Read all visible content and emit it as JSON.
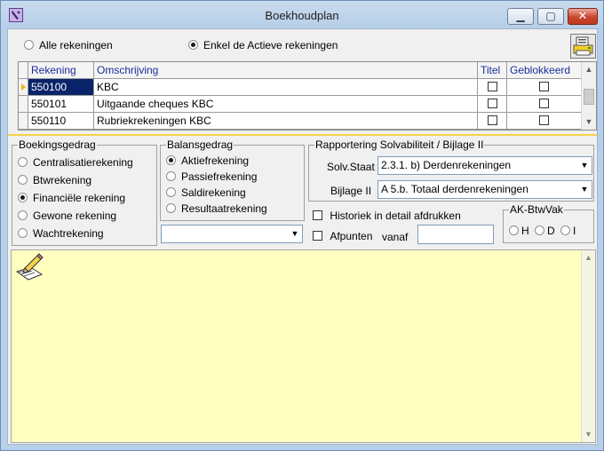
{
  "window": {
    "title": "Boekhoudplan",
    "min": "▁",
    "max": "▢",
    "close": "✕"
  },
  "filter": {
    "all_label": "Alle rekeningen",
    "active_label": "Enkel de Actieve rekeningen",
    "selected": "active"
  },
  "grid": {
    "headers": [
      "Rekening",
      "Omschrijving",
      "Titel",
      "Geblokkeerd"
    ],
    "rows": [
      {
        "rekening": "550100",
        "omschrijving": "KBC",
        "titel": false,
        "geblokkeerd": false
      },
      {
        "rekening": "550101",
        "omschrijving": "Uitgaande cheques KBC",
        "titel": false,
        "geblokkeerd": false
      },
      {
        "rekening": "550110",
        "omschrijving": "Rubriekrekeningen KBC",
        "titel": false,
        "geblokkeerd": false
      }
    ]
  },
  "boekingsgedrag": {
    "legend": "Boekingsgedrag",
    "options": [
      "Centralisatierekening",
      "Btwrekening",
      "Financiële rekening",
      "Gewone rekening",
      "Wachtrekening"
    ],
    "selected": "Financiële rekening"
  },
  "balansgedrag": {
    "legend": "Balansgedrag",
    "options": [
      "Aktiefrekening",
      "Passiefrekening",
      "Saldirekening",
      "Resultaatrekening"
    ],
    "selected": "Aktiefrekening",
    "combo_value": ""
  },
  "rapportering": {
    "legend": "Rapportering Solvabiliteit / Bijlage II",
    "solv_label": "Solv.Staat",
    "solv_value": "2.3.1. b) Derdenrekeningen",
    "bijlage_label": "Bijlage II",
    "bijlage_value": "A 5.b. Totaal derdenrekeningen"
  },
  "options": {
    "historiek_label": "Historiek in detail afdrukken",
    "afpunten_label": "Afpunten",
    "vanaf_label": "vanaf",
    "vanaf_value": ""
  },
  "ak_btwvak": {
    "legend": "AK-BtwVak",
    "options": [
      "H",
      "D",
      "I"
    ]
  },
  "icons": {
    "dropdown": "▼",
    "scroll_up": "▲",
    "scroll_down": "▼"
  }
}
